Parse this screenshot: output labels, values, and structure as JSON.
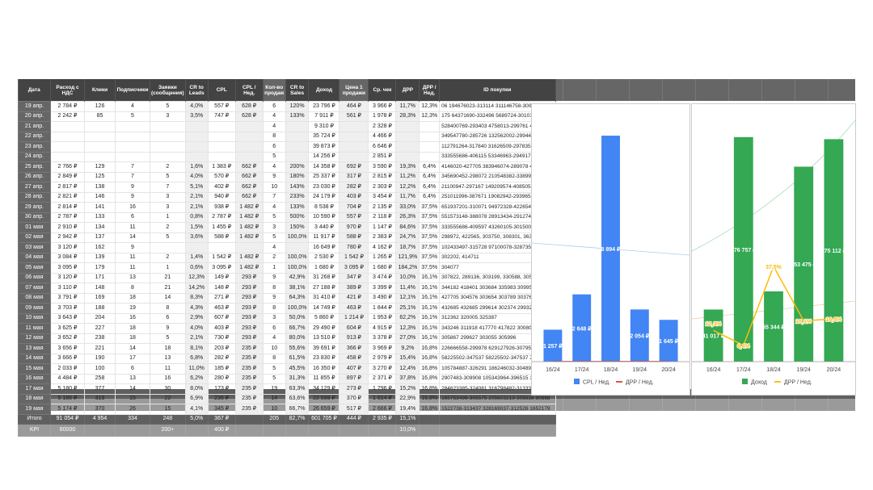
{
  "table": {
    "headers": [
      "Дата",
      "Расход с НДС",
      "Клики",
      "Подписчики",
      "Заявки (сообщения)",
      "CR to Leads",
      "CPL",
      "CPL / Нед.",
      "Кол-во продаж",
      "CR to Sales",
      "Доход",
      "Цена 1 продажи",
      "Ср. чек",
      "ДРР",
      "ДРР / Нед.",
      "ID покупки"
    ],
    "rows": [
      [
        "19 апр.",
        "2 784 ₽",
        "126",
        "4",
        "5",
        "4,0%",
        "557 ₽",
        "628 ₽",
        "6",
        "120%",
        "23 796 ₽",
        "464 ₽",
        "3 966 ₽",
        "11,7%",
        "12,3%",
        "06 194676023-313114 311146758-300630 6795"
      ],
      [
        "20 апр.",
        "2 242 ₽",
        "85",
        "5",
        "3",
        "3,5%",
        "747 ₽",
        "628 ₽",
        "4",
        "133%",
        "7 911 ₽",
        "561 ₽",
        "1 978 ₽",
        "28,3%",
        "12,3%",
        "175 64371690-332496 5689724-301016 25538"
      ],
      [
        "21 апр.",
        "",
        "",
        "",
        "",
        "",
        "",
        "",
        "4",
        "",
        "9 310 ₽",
        "",
        "2 328 ₽",
        "",
        "",
        "528400769-293403 4758013-299761 4514519"
      ],
      [
        "22 апр.",
        "",
        "",
        "",
        "",
        "",
        "",
        "",
        "8",
        "",
        "35 724 ₽",
        "",
        "4 466 ₽",
        "",
        "",
        "349547780-285726 132562002-299440 40093"
      ],
      [
        "23 апр.",
        "",
        "",
        "",
        "",
        "",
        "",
        "",
        "6",
        "",
        "39 873 ₽",
        "",
        "6 646 ₽",
        "",
        "",
        "112791264-317840 31626509-297835 297431"
      ],
      [
        "24 апр.",
        "",
        "",
        "",
        "",
        "",
        "",
        "",
        "5",
        "",
        "14 256 ₽",
        "",
        "2 851 ₽",
        "",
        "",
        "333555686-406115 53346963-294917 193839"
      ],
      [
        "25 апр.",
        "2 766 ₽",
        "129",
        "7",
        "2",
        "1,6%",
        "1 383 ₽",
        "662 ₽",
        "4",
        "200%",
        "14 358 ₽",
        "692 ₽",
        "3 590 ₽",
        "19,3%",
        "6,4%",
        "4146020-427705 383946074-289078 4385790"
      ],
      [
        "26 апр.",
        "2 849 ₽",
        "125",
        "7",
        "5",
        "4,0%",
        "570 ₽",
        "662 ₽",
        "9",
        "180%",
        "25 337 ₽",
        "317 ₽",
        "2 815 ₽",
        "11,2%",
        "6,4%",
        "345690452-298072 210548382-338994 46717"
      ],
      [
        "27 апр.",
        "2 817 ₽",
        "138",
        "9",
        "7",
        "5,1%",
        "402 ₽",
        "662 ₽",
        "10",
        "143%",
        "23 030 ₽",
        "282 ₽",
        "2 303 ₽",
        "12,2%",
        "6,4%",
        "21100947-297167 149209574-408505 555161"
      ],
      [
        "28 апр.",
        "2 821 ₽",
        "146",
        "9",
        "3",
        "2,1%",
        "940 ₽",
        "662 ₽",
        "7",
        "233%",
        "24 179 ₽",
        "403 ₽",
        "3 454 ₽",
        "11,7%",
        "6,4%",
        "251011996-387671 19082942-293965 190829"
      ],
      [
        "29 апр.",
        "2 814 ₽",
        "141",
        "16",
        "3",
        "2,1%",
        "938 ₽",
        "1 482 ₽",
        "4",
        "133%",
        "8 538 ₽",
        "704 ₽",
        "2 135 ₽",
        "33,0%",
        "37,5%",
        "651937201-310071 94972328-422654 471334"
      ],
      [
        "30 апр.",
        "2 787 ₽",
        "133",
        "6",
        "1",
        "0,8%",
        "2 787 ₽",
        "1 482 ₽",
        "5",
        "500%",
        "10 590 ₽",
        "557 ₽",
        "2 118 ₽",
        "26,3%",
        "37,5%",
        "551573148-388078  28913434-291274 499127"
      ],
      [
        "01 мая",
        "2 910 ₽",
        "134",
        "11",
        "2",
        "1,5%",
        "1 455 ₽",
        "1 482 ₽",
        "3",
        "150%",
        "3 440 ₽",
        "970 ₽",
        "1 147 ₽",
        "84,6%",
        "37,5%",
        "333555686-409597 43260105-301500 524054"
      ],
      [
        "02 мая",
        "2 942 ₽",
        "137",
        "14",
        "5",
        "3,6%",
        "588 ₽",
        "1 482 ₽",
        "5",
        "100,0%",
        "11 917 ₽",
        "588 ₽",
        "2 383 ₽",
        "24,7%",
        "37,5%",
        "298972, 422565, 303750, 308301, 363432"
      ],
      [
        "03 мая",
        "3 120 ₽",
        "162",
        "9",
        "",
        "",
        "",
        "",
        "4",
        "",
        "16 649 ₽",
        "780 ₽",
        "4 162 ₽",
        "18,7%",
        "37,5%",
        "102433497-315728 97100078-328735 303073"
      ],
      [
        "04 мая",
        "3 084 ₽",
        "139",
        "11",
        "2",
        "1,4%",
        "1 542 ₽",
        "1 482 ₽",
        "2",
        "100,0%",
        "2 530 ₽",
        "1 542 ₽",
        "1 265 ₽",
        "121,9%",
        "37,5%",
        "302202, 414711"
      ],
      [
        "05 мая",
        "3 095 ₽",
        "179",
        "11",
        "1",
        "0,6%",
        "3 095 ₽",
        "1 482 ₽",
        "1",
        "100,0%",
        "1 680 ₽",
        "3 095 ₽",
        "1 680 ₽",
        "184,2%",
        "37,5%",
        "304077"
      ],
      [
        "06 мая",
        "3 120 ₽",
        "171",
        "13",
        "21",
        "12,3%",
        "149 ₽",
        "293 ₽",
        "9",
        "42,9%",
        "31 268 ₽",
        "347 ₽",
        "3 474 ₽",
        "10,0%",
        "16,1%",
        "307822, 289136, 303199, 330588, 305988,"
      ],
      [
        "07 мая",
        "3 110 ₽",
        "148",
        "8",
        "21",
        "14,2%",
        "148 ₽",
        "293 ₽",
        "8",
        "38,1%",
        "27 188 ₽",
        "389 ₽",
        "3 399 ₽",
        "11,4%",
        "16,1%",
        "344182 418401 303684 335983 309957 29864"
      ],
      [
        "08 мая",
        "3 791 ₽",
        "169",
        "18",
        "14",
        "8,3%",
        "271 ₽",
        "293 ₽",
        "9",
        "64,3%",
        "31 410 ₽",
        "421 ₽",
        "3 490 ₽",
        "12,1%",
        "16,1%",
        "427705 304576 303654 303789 303769 29081"
      ],
      [
        "09 мая",
        "3 703 ₽",
        "188",
        "19",
        "8",
        "4,3%",
        "463 ₽",
        "293 ₽",
        "8",
        "100,0%",
        "14 749 ₽",
        "463 ₽",
        "1 844 ₽",
        "25,1%",
        "16,1%",
        "432685 432685 299614 302374 299326 39315"
      ],
      [
        "10 мая",
        "3 643 ₽",
        "204",
        "16",
        "6",
        "2,9%",
        "607 ₽",
        "293 ₽",
        "3",
        "50,0%",
        "5 860 ₽",
        "1 214 ₽",
        "1 953 ₽",
        "62,2%",
        "16,1%",
        "312362 320005 325387"
      ],
      [
        "11 мая",
        "3 625 ₽",
        "227",
        "18",
        "9",
        "4,0%",
        "403 ₽",
        "293 ₽",
        "6",
        "66,7%",
        "29 490 ₽",
        "604 ₽",
        "4 915 ₽",
        "12,3%",
        "16,1%",
        "343246 311918 417770 417822 300803 33210"
      ],
      [
        "12 мая",
        "3 652 ₽",
        "238",
        "18",
        "5",
        "2,1%",
        "730 ₽",
        "293 ₽",
        "4",
        "80,0%",
        "13 510 ₽",
        "913 ₽",
        "3 378 ₽",
        "27,0%",
        "16,1%",
        "305867 299627 303055 305996"
      ],
      [
        "13 мая",
        "3 656 ₽",
        "221",
        "14",
        "18",
        "8,1%",
        "203 ₽",
        "235 ₽",
        "10",
        "55,6%",
        "39 691 ₽",
        "366 ₽",
        "3 969 ₽",
        "9,2%",
        "16,8%",
        "226666558-299978 629127926-307955 13834"
      ],
      [
        "14 мая",
        "3 666 ₽",
        "190",
        "17",
        "13",
        "6,8%",
        "282 ₽",
        "235 ₽",
        "8",
        "61,5%",
        "23 830 ₽",
        "458 ₽",
        "2 979 ₽",
        "15,4%",
        "16,8%",
        "58225502-347537 58225502-347537 7434627"
      ],
      [
        "15 мая",
        "2 033 ₽",
        "100",
        "6",
        "11",
        "11,0%",
        "185 ₽",
        "235 ₽",
        "5",
        "45,5%",
        "16 350 ₽",
        "407 ₽",
        "3 270 ₽",
        "12,4%",
        "16,8%",
        "105784887-326291 186246032-304896 35947"
      ],
      [
        "16 мая",
        "4 484 ₽",
        "258",
        "13",
        "16",
        "6,2%",
        "280 ₽",
        "235 ₽",
        "5",
        "31,3%",
        "11 855 ₽",
        "897 ₽",
        "2 371 ₽",
        "37,8%",
        "16,8%",
        "2907483-309908 105343964-396515 1767115"
      ],
      [
        "17 мая",
        "5 180 ₽",
        "377",
        "14",
        "30",
        "8,0%",
        "173 ₽",
        "235 ₽",
        "19",
        "63,3%",
        "34 129 ₽",
        "273 ₽",
        "1 796 ₽",
        "15,2%",
        "16,8%",
        "284623385-324081 316798482-313339 15709"
      ],
      [
        "18 мая",
        "5 186 ₽",
        "319",
        "15",
        "22",
        "6,9%",
        "236 ₽",
        "235 ₽",
        "14",
        "63,6%",
        "22 598 ₽",
        "370 ₽",
        "1 614 ₽",
        "22,9%",
        "16,8%",
        "165753496-305575 205603219-308638 80868"
      ],
      [
        "19 мая",
        "5 174 ₽",
        "370",
        "26",
        "15",
        "4,1%",
        "345 ₽",
        "235 ₽",
        "10",
        "66,7%",
        "26 659 ₽",
        "517 ₽",
        "2 666 ₽",
        "19,4%",
        "16,8%",
        "1522738-313437 328169037-312526 1652179"
      ]
    ],
    "total": [
      "Итого",
      "91 054 ₽",
      "4 954",
      "334",
      "248",
      "5,0%",
      "367 ₽",
      "",
      "205",
      "82,7%",
      "601 705 ₽",
      "444 ₽",
      "2 935 ₽",
      "15,1%",
      "",
      ""
    ],
    "kpi": [
      "KPI",
      "80000",
      "",
      "",
      "200+",
      "",
      "400 ₽",
      "",
      "",
      "",
      "",
      "",
      "",
      "10,0%",
      "",
      ""
    ]
  },
  "chart_data": [
    {
      "type": "bar",
      "categories": [
        "16/24",
        "17/24",
        "18/24",
        "19/24",
        "20/24"
      ],
      "series": [
        {
          "name": "CPL / Нед.",
          "type": "bar",
          "color": "#4285f4",
          "values": [
            1257,
            2648,
            8894,
            2054,
            1645
          ],
          "labels": [
            "1 257 ₽",
            "2 648 ₽",
            "8 894 ₽",
            "2 054 ₽",
            "1 645 ₽"
          ]
        },
        {
          "name": "ДРР / Нед.",
          "type": "line",
          "color": "#db4437",
          "values": [
            0.123,
            0.064,
            0.375,
            0.161,
            0.168
          ]
        }
      ],
      "trendline": true,
      "ylim": [
        0,
        9500
      ],
      "grid": false,
      "legend": "bottom"
    },
    {
      "type": "bar",
      "categories": [
        "16/24",
        "17/24",
        "18/24",
        "19/24",
        "20/24"
      ],
      "series": [
        {
          "name": "Доход",
          "type": "bar",
          "color": "#34a853",
          "values": [
            41017,
            176757,
            55344,
            153475,
            175112
          ],
          "labels": [
            "41 017 ₽",
            "176 757 ₽",
            "55 344 ₽",
            "153 475 ₽",
            "175 112 ₽"
          ]
        },
        {
          "name": "ДРР / Нед.",
          "type": "line",
          "color": "#fbbc04",
          "values": [
            12.3,
            6.4,
            37.5,
            16.1,
            16.8
          ],
          "labels": [
            "12,3%",
            "6,4%",
            "37,5%",
            "16,1%",
            "16,8%"
          ]
        }
      ],
      "trendline": true,
      "ylim": [
        0,
        190000
      ],
      "ylim_secondary": [
        0,
        95
      ],
      "grid": false,
      "legend": "bottom"
    }
  ]
}
